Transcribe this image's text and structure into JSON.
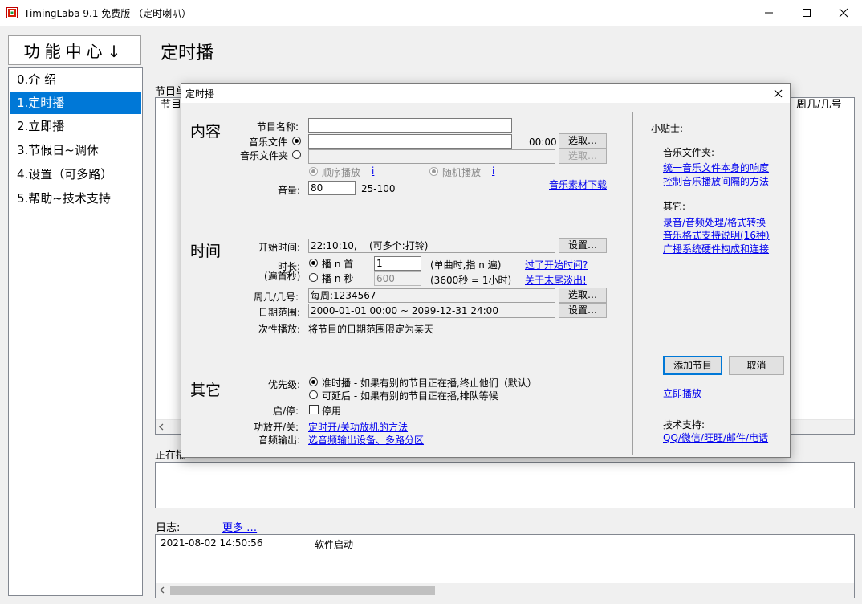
{
  "window": {
    "title": "TimingLaba 9.1 免费版 （定时喇叭）",
    "minimize_glyph": "—",
    "maximize_glyph": "☐",
    "close_glyph": "✕"
  },
  "sidebar": {
    "header": "功能中心↓",
    "items": [
      {
        "label": "0.介 绍"
      },
      {
        "label": "1.定时播"
      },
      {
        "label": "2.立即播"
      },
      {
        "label": "3.节假日~调休"
      },
      {
        "label": "4.设置（可多路）"
      },
      {
        "label": "5.帮助~技术支持"
      }
    ],
    "selected_index": 1
  },
  "main": {
    "page_title": "定时播",
    "program_list_label": "节目单",
    "columns": {
      "first": "节目",
      "weekday": "周几/几号"
    },
    "playing_label": "正在播",
    "log_label": "日志:",
    "log_more": "更多 …",
    "log_rows": [
      {
        "time": "2021-08-02 14:50:56",
        "message": "软件启动"
      }
    ]
  },
  "dialog": {
    "title": "定时播",
    "close_glyph": "✕",
    "content": {
      "section": "内容",
      "name_label": "节目名称:",
      "name_value": "",
      "music_file_label": "音乐文件",
      "music_file_value": "",
      "music_duration": "00:00",
      "choose_label": "选取…",
      "music_folder_label": "音乐文件夹",
      "music_folder_value": "",
      "choose_disabled_label": "选取…",
      "seq_play_label": "顺序播放",
      "random_play_label": "随机播放",
      "info_mark": "i",
      "volume_label": "音量:",
      "volume_value": "80",
      "volume_range": "25-100",
      "download_link": "音乐素材下载"
    },
    "time": {
      "section": "时间",
      "start_label": "开始时间:",
      "start_value": "22:10:10,    (可多个:打铃)",
      "settings_label": "设置…",
      "duration_label": "时长:",
      "duration_sub": "(遍首秒)",
      "play_n_first_label": "播 n 首",
      "play_n_first_value": "1",
      "play_n_first_note": "(单曲时,指 n 遍)",
      "play_n_sec_label": "播 n 秒",
      "play_n_sec_value": "600",
      "play_n_sec_note": "(3600秒 = 1小时)",
      "missed_link": "过了开始时间?",
      "fade_link": "关于末尾淡出!",
      "weekday_label": "周几/几号:",
      "weekday_value": "每周:1234567",
      "weekday_button": "选取…",
      "date_range_label": "日期范围:",
      "date_range_value": "2000-01-01 00:00 ~ 2099-12-31 24:00",
      "date_range_button": "设置…",
      "once_label": "一次性播放:",
      "once_value": "将节目的日期范围限定为某天"
    },
    "other": {
      "section": "其它",
      "priority_label": "优先级:",
      "priority_option1": "准时播 - 如果有别的节目正在播,终止他们（默认）",
      "priority_option2": "可延后 - 如果有别的节目正在播,排队等候",
      "enable_label": "启/停:",
      "disable_label": "停用",
      "power_label": "功放开/关:",
      "power_link": "定时开/关功放机的方法",
      "audio_label": "音频输出:",
      "audio_link": "选音频输出设备、多路分区"
    },
    "tips": {
      "title": "小贴士:",
      "folder_title": "音乐文件夹:",
      "folder_links": [
        "统一音乐文件本身的响度",
        "控制音乐播放间隔的方法"
      ],
      "other_title": "其它:",
      "other_links": [
        "录音/音频处理/格式转换",
        "音乐格式支持说明(16种)",
        "广播系统硬件构成和连接"
      ],
      "add_button": "添加节目",
      "cancel_button": "取消",
      "play_now_link": "立即播放",
      "support_title": "技术支持:",
      "support_link": "QQ/微信/旺旺/邮件/电话"
    }
  }
}
